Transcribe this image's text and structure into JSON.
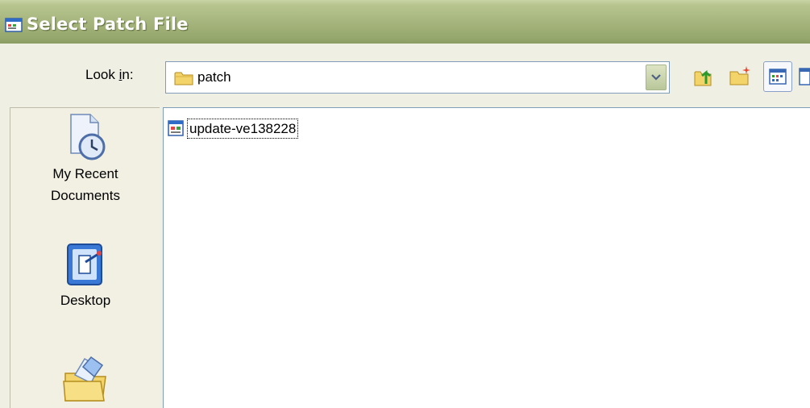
{
  "window": {
    "title": "Select Patch File",
    "title_icon": "dialog-app-icon"
  },
  "lookin": {
    "label_prefix": "Look ",
    "label_underlined": "i",
    "label_suffix": "n:",
    "current_folder": "patch",
    "folder_icon": "folder-icon"
  },
  "toolbar": {
    "buttons": [
      "up-one-level-icon",
      "new-folder-icon",
      "view-menu-icon"
    ]
  },
  "places": [
    {
      "label_line1": "My Recent",
      "label_line2": "Documents",
      "icon": "recent-documents-icon"
    },
    {
      "label_line1": "Desktop",
      "label_line2": "",
      "icon": "desktop-icon"
    },
    {
      "label_line1": "",
      "label_line2": "",
      "icon": "my-documents-icon"
    }
  ],
  "files": [
    {
      "name": "update-ve138228",
      "icon": "patch-file-icon",
      "selected": true
    }
  ],
  "colors": {
    "titlebar": "#a6b57d",
    "dialog_bg": "#efefe4",
    "combo_border": "#7f9db9"
  }
}
